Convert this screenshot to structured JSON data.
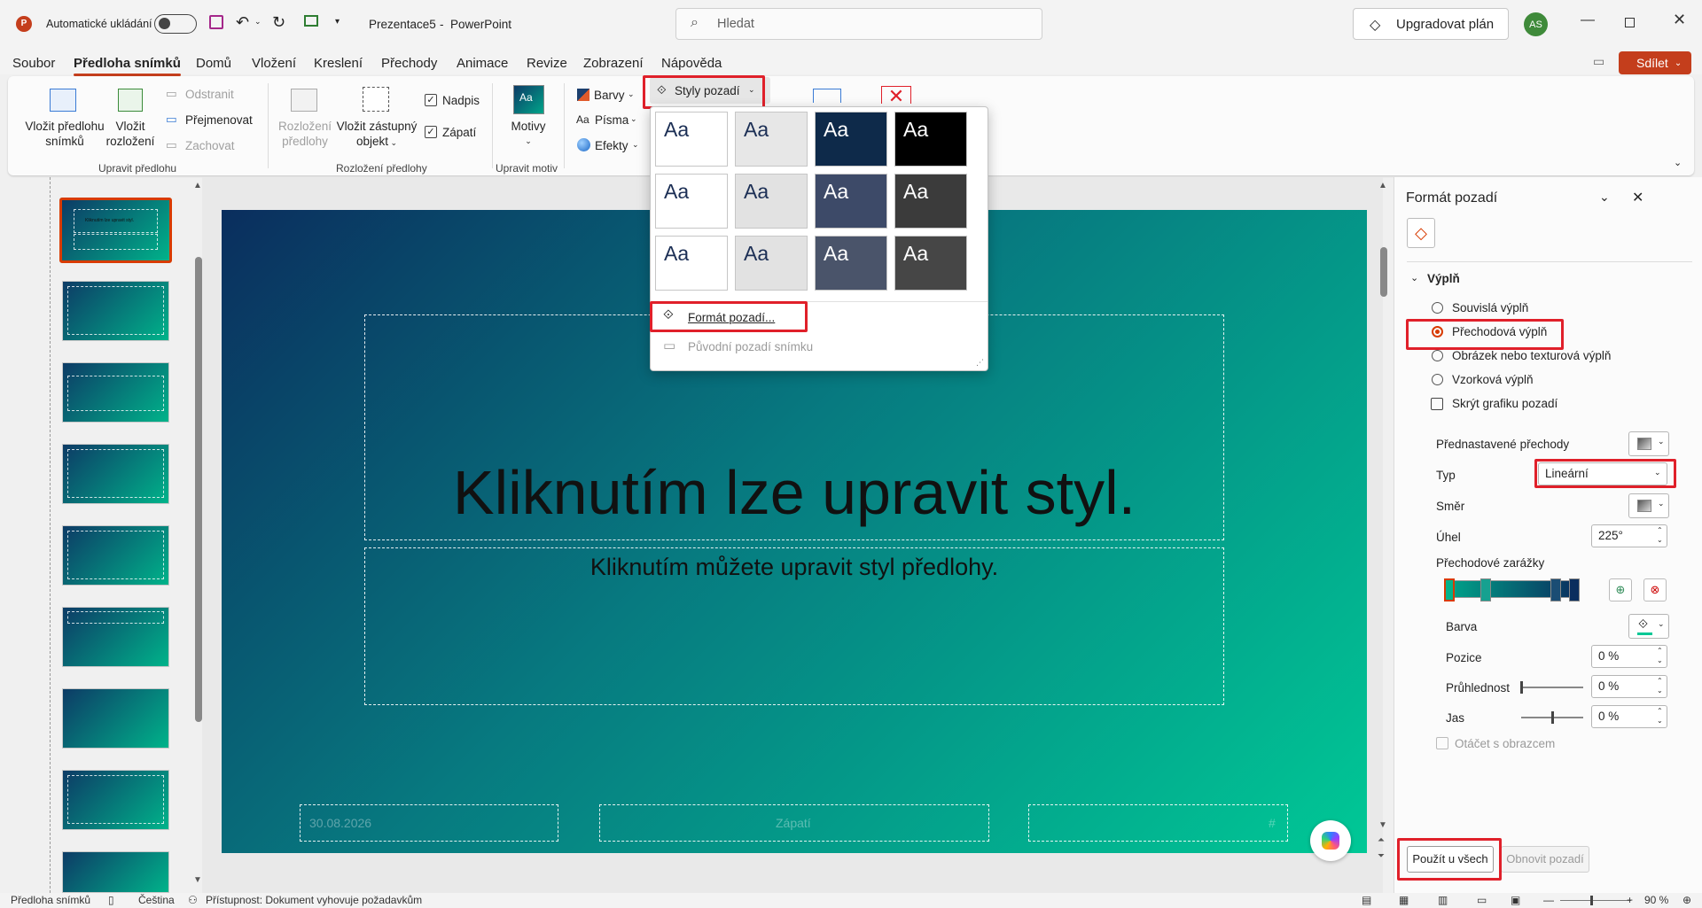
{
  "titlebar": {
    "autosave_label": "Automatické ukládání",
    "doc_title": "Prezentace5",
    "dash": "-",
    "app_name": "PowerPoint",
    "search_placeholder": "Hledat",
    "upgrade_label": "Upgradovat plán",
    "avatar_initials": "AS"
  },
  "menu": {
    "tabs": [
      "Soubor",
      "Předloha snímků",
      "Domů",
      "Vložení",
      "Kreslení",
      "Přechody",
      "Animace",
      "Revize",
      "Zobrazení",
      "Nápověda"
    ],
    "active_tab": "Předloha snímků",
    "share_label": "Sdílet"
  },
  "ribbon": {
    "insert_master_1": "Vložit předlohu",
    "insert_master_2": "snímků",
    "insert_layout_1": "Vložit",
    "insert_layout_2": "rozložení",
    "delete": "Odstranit",
    "rename": "Přejmenovat",
    "preserve": "Zachovat",
    "group_edit_master": "Upravit předlohu",
    "master_layout_1": "Rozložení",
    "master_layout_2": "předlohy",
    "insert_placeholder_1": "Vložit zástupný",
    "insert_placeholder_2": "objekt",
    "title_check": "Nadpis",
    "footer_check": "Zápatí",
    "group_master_layout": "Rozložení předlohy",
    "themes": "Motivy",
    "group_edit_theme": "Upravit motiv",
    "colors": "Barvy",
    "fonts": "Písma",
    "effects": "Efekty",
    "bg_styles": "Styly pozadí"
  },
  "dropdown": {
    "swatch_label": "Aa",
    "format_background": "Formát pozadí...",
    "reset_background": "Původní pozadí snímku"
  },
  "slide": {
    "title": "Kliknutím lze upravit styl.",
    "subtitle": "Kliknutím můžete upravit styl předlohy.",
    "date": "30.08.2026",
    "footer": "Zápatí",
    "page_num": "#",
    "thumb_title": "Kliknutím lze upravit styl."
  },
  "pane": {
    "title": "Formát pozadí",
    "section_fill": "Výplň",
    "fill_solid": "Souvislá výplň",
    "fill_gradient": "Přechodová výplň",
    "fill_picture": "Obrázek nebo texturová výplň",
    "fill_pattern": "Vzorková výplň",
    "hide_graphics": "Skrýt grafiku pozadí",
    "preset_gradients": "Přednastavené přechody",
    "type_label": "Typ",
    "type_value": "Lineární",
    "direction_label": "Směr",
    "angle_label": "Úhel",
    "angle_value": "225°",
    "gradient_stops": "Přechodové zarážky",
    "color_label": "Barva",
    "position_label": "Pozice",
    "position_value": "0 %",
    "transparency_label": "Průhlednost",
    "transparency_value": "0 %",
    "brightness_label": "Jas",
    "brightness_value": "0 %",
    "rotate_with_shape": "Otáčet s obrazcem",
    "apply_all": "Použít u všech",
    "reset_bg": "Obnovit pozadí"
  },
  "status": {
    "view_label": "Předloha snímků",
    "language": "Čeština",
    "accessibility": "Přístupnost: Dokument vyhovuje požadavkům",
    "zoom": "90 %"
  },
  "colors": {
    "accent": "#c43e1c",
    "highlight": "#e0202a",
    "grad_start": "#0a2e5e",
    "grad_end": "#00c896"
  }
}
